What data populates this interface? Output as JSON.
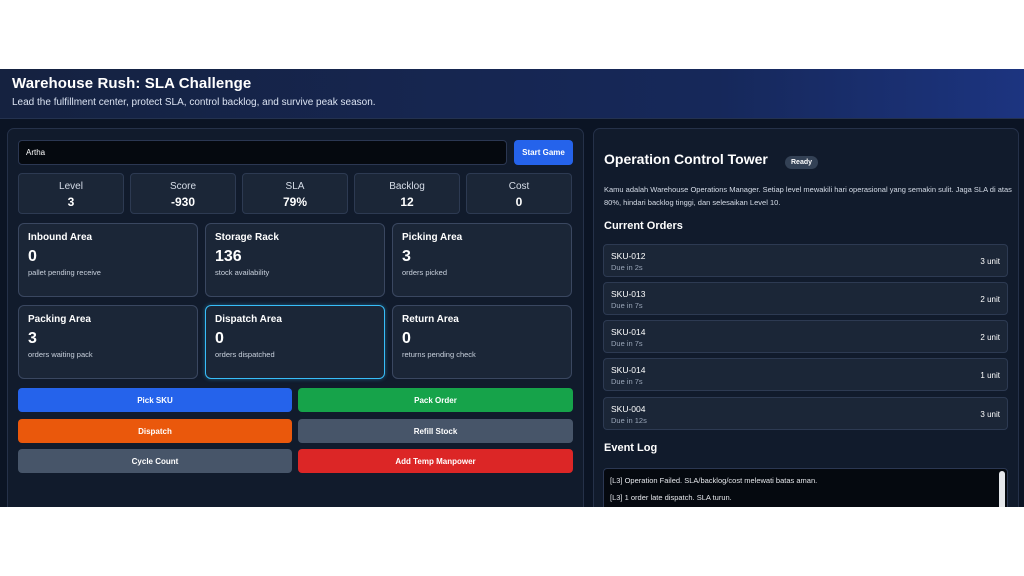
{
  "header": {
    "title": "Warehouse Rush: SLA Challenge",
    "subtitle": "Lead the fulfillment center, protect SLA, control backlog, and survive peak season."
  },
  "player": {
    "name_value": "Artha",
    "start_label": "Start Game"
  },
  "stats": [
    {
      "label": "Level",
      "value": "3"
    },
    {
      "label": "Score",
      "value": "-930"
    },
    {
      "label": "SLA",
      "value": "79%"
    },
    {
      "label": "Backlog",
      "value": "12"
    },
    {
      "label": "Cost",
      "value": "0"
    }
  ],
  "areas": [
    {
      "title": "Inbound Area",
      "value": "0",
      "sub": "pallet pending receive"
    },
    {
      "title": "Storage Rack",
      "value": "136",
      "sub": "stock availability"
    },
    {
      "title": "Picking Area",
      "value": "3",
      "sub": "orders picked"
    },
    {
      "title": "Packing Area",
      "value": "3",
      "sub": "orders waiting pack"
    },
    {
      "title": "Dispatch Area",
      "value": "0",
      "sub": "orders dispatched"
    },
    {
      "title": "Return Area",
      "value": "0",
      "sub": "returns pending check"
    }
  ],
  "actions": {
    "pick_sku": "Pick SKU",
    "pack_order": "Pack Order",
    "dispatch": "Dispatch",
    "refill_stock": "Refill Stock",
    "cycle_count": "Cycle Count",
    "add_temp_manpower": "Add Temp Manpower"
  },
  "colors": {
    "pick_sku": "#2563eb",
    "pack_order": "#16a34a",
    "dispatch": "#ea580c",
    "refill_stock": "#475569",
    "cycle_count": "#475569",
    "add_temp_manpower": "#dc2626",
    "active_area_border": "#38bdf8"
  },
  "control_tower": {
    "title": "Operation Control Tower",
    "status": "Ready",
    "description": "Kamu adalah Warehouse Operations Manager. Setiap level mewakili hari operasional yang semakin sulit. Jaga SLA di atas 80%, hindari backlog tinggi, dan selesaikan Level 10.",
    "orders_heading": "Current Orders",
    "orders": [
      {
        "sku": "SKU-012",
        "due": "Due in 2s",
        "qty": "3 unit"
      },
      {
        "sku": "SKU-013",
        "due": "Due in 7s",
        "qty": "2 unit"
      },
      {
        "sku": "SKU-014",
        "due": "Due in 7s",
        "qty": "2 unit"
      },
      {
        "sku": "SKU-014",
        "due": "Due in 7s",
        "qty": "1 unit"
      },
      {
        "sku": "SKU-004",
        "due": "Due in 12s",
        "qty": "3 unit"
      }
    ],
    "log_heading": "Event Log",
    "log": [
      "[L3] Operation Failed. SLA/backlog/cost melewati batas aman.",
      "[L3] 1 order late dispatch. SLA turun."
    ]
  }
}
